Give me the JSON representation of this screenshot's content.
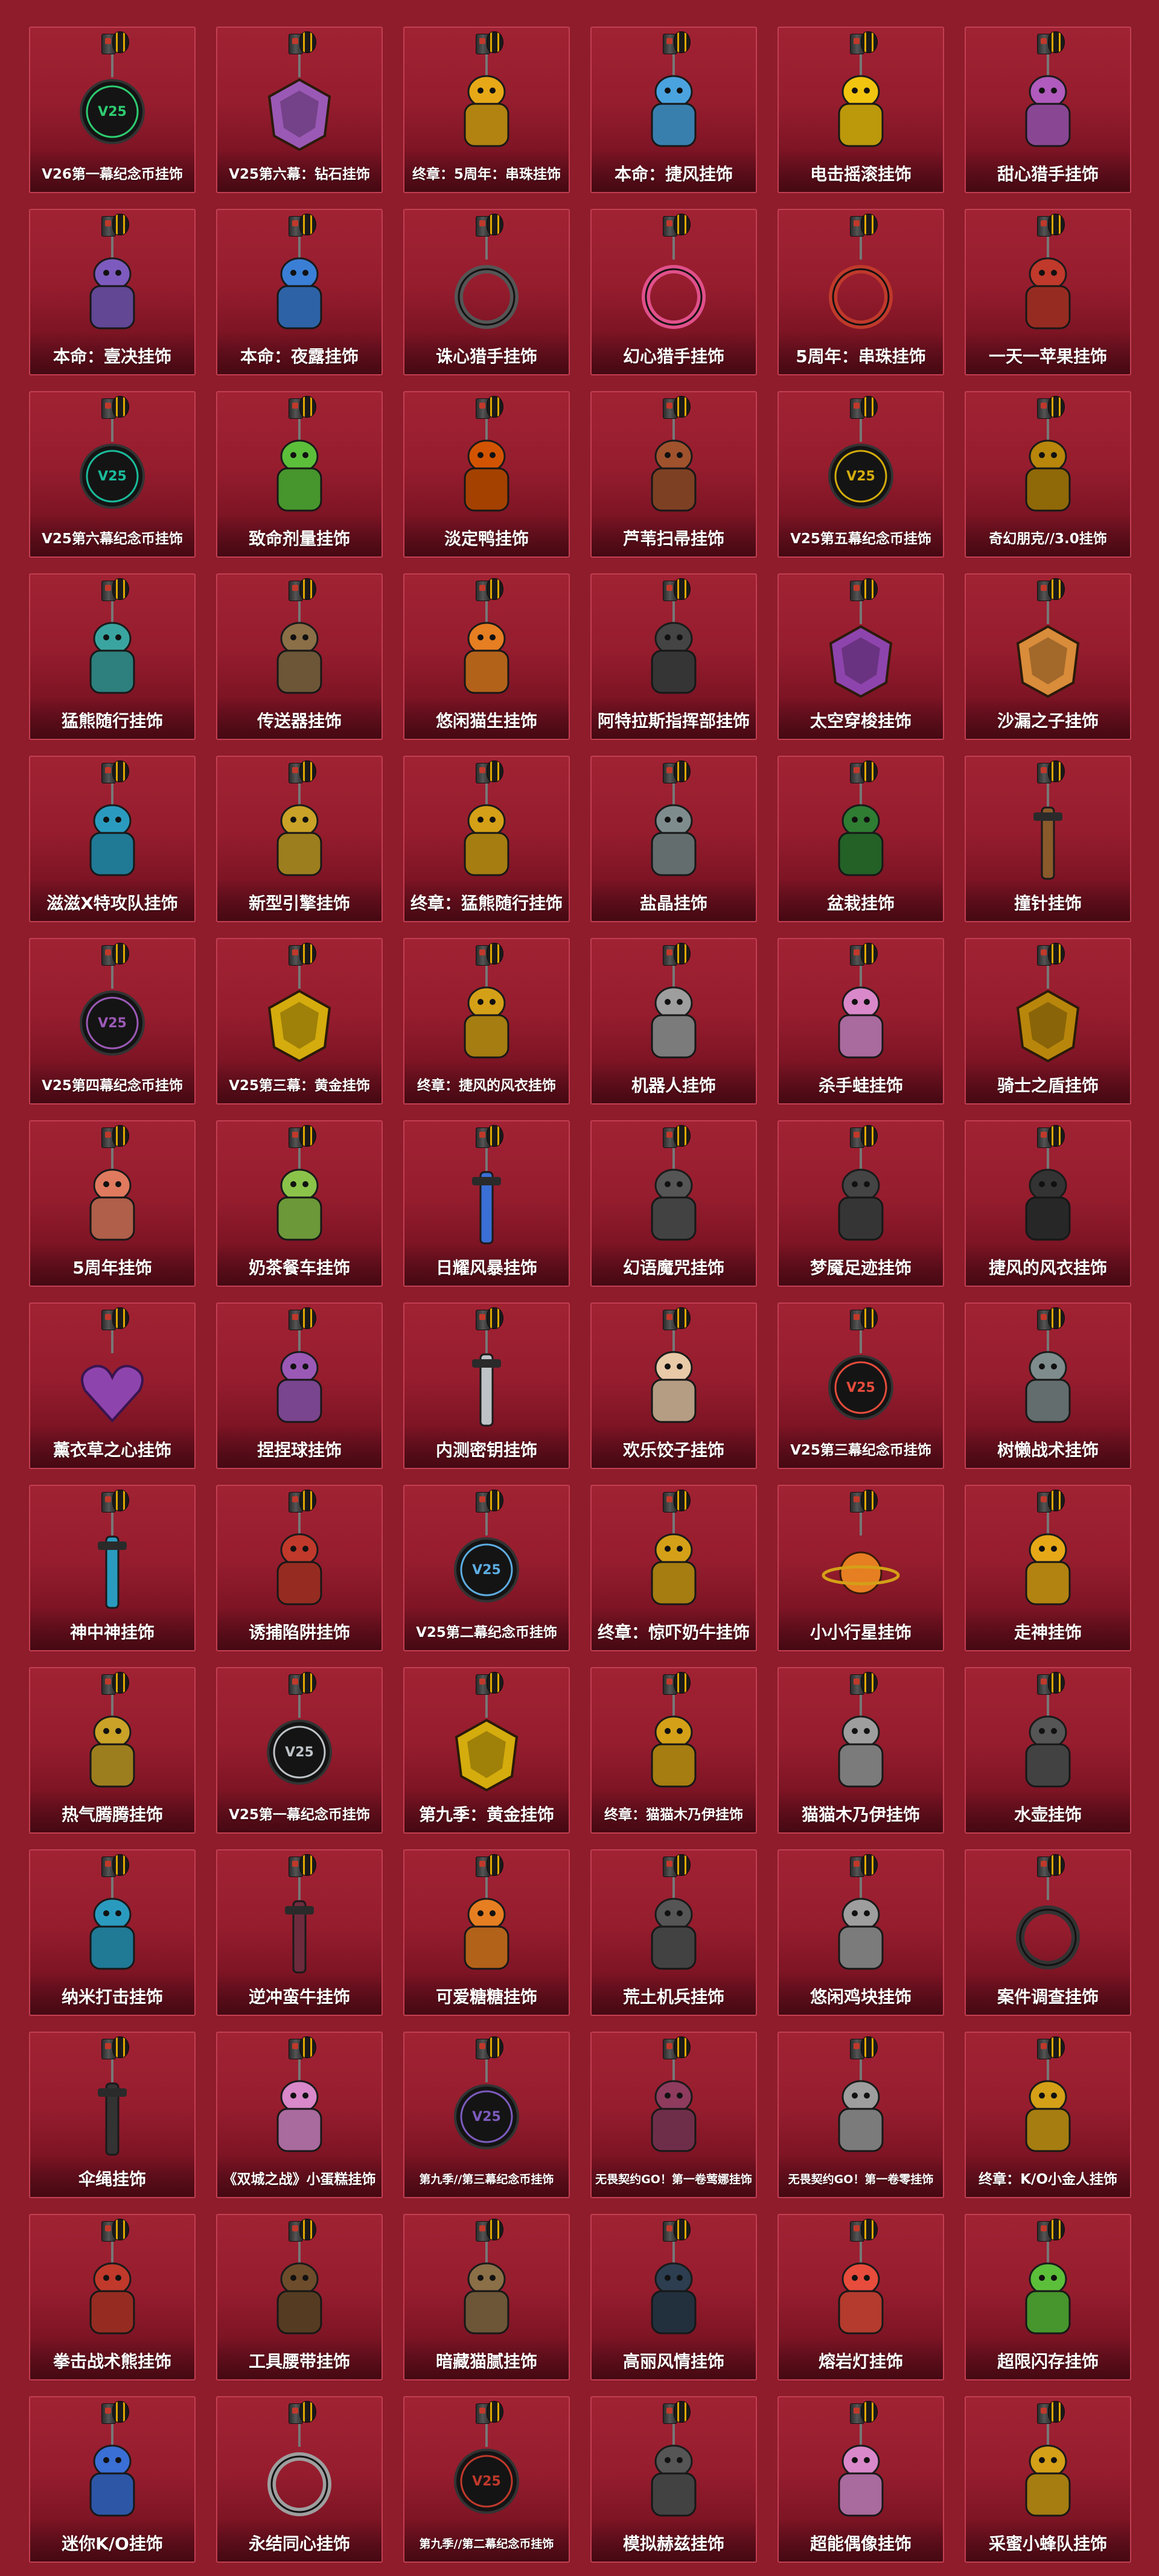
{
  "grid": {
    "columns": 6,
    "items": [
      {
        "label": "V26第一幕纪念币挂饰",
        "icon": "medallion-icon",
        "color": "#2ecc71"
      },
      {
        "label": "V25第六幕：钻石挂饰",
        "icon": "diamond-badge-icon",
        "color": "#9b59b6"
      },
      {
        "label": "终章：5周年：串珠挂饰",
        "icon": "bead-five-icon",
        "color": "#e6a817"
      },
      {
        "label": "本命：捷风挂饰",
        "icon": "character-figure-icon",
        "color": "#4aa3df"
      },
      {
        "label": "电击摇滚挂饰",
        "icon": "lightning-icon",
        "color": "#f1c40f"
      },
      {
        "label": "甜心猎手挂饰",
        "icon": "backpack-icon",
        "color": "#b05bbd"
      },
      {
        "label": "本命：壹决挂饰",
        "icon": "character-figure-icon",
        "color": "#7d5bbe"
      },
      {
        "label": "本命：夜露挂饰",
        "icon": "character-figure-icon",
        "color": "#3a7fd5"
      },
      {
        "label": "诛心猎手挂饰",
        "icon": "headphones-icon",
        "color": "#555555"
      },
      {
        "label": "幻心猎手挂饰",
        "icon": "headphones-icon",
        "color": "#e0508a"
      },
      {
        "label": "5周年：串珠挂饰",
        "icon": "bead-ring-icon",
        "color": "#c0392b"
      },
      {
        "label": "一天一苹果挂饰",
        "icon": "apple-icon",
        "color": "#c0392b"
      },
      {
        "label": "V25第六幕纪念币挂饰",
        "icon": "medallion-icon",
        "color": "#1abc9c"
      },
      {
        "label": "致命剂量挂饰",
        "icon": "snake-icon",
        "color": "#5cbf3a"
      },
      {
        "label": "淡定鸭挂饰",
        "icon": "duck-jar-icon",
        "color": "#d35400"
      },
      {
        "label": "芦苇扫帚挂饰",
        "icon": "broom-icon",
        "color": "#a0522d"
      },
      {
        "label": "V25第五幕纪念币挂饰",
        "icon": "medallion-icon",
        "color": "#d4ac0d"
      },
      {
        "label": "奇幻朋克//3.0挂饰",
        "icon": "helmet-icon",
        "color": "#b8860b"
      },
      {
        "label": "猛熊随行挂饰",
        "icon": "bear-icon",
        "color": "#3aa5a0"
      },
      {
        "label": "传送器挂饰",
        "icon": "teleporter-icon",
        "color": "#8b6f47"
      },
      {
        "label": "悠闲猫生挂饰",
        "icon": "lantern-icon",
        "color": "#e67e22"
      },
      {
        "label": "阿特拉斯指挥部挂饰",
        "icon": "atlas-logo-icon",
        "color": "#444444"
      },
      {
        "label": "太空穿梭挂饰",
        "icon": "shuttle-tag-icon",
        "color": "#8e44ad"
      },
      {
        "label": "沙漏之子挂饰",
        "icon": "hourglass-tag-icon",
        "color": "#d98c3a"
      },
      {
        "label": "滋滋X特攻队挂饰",
        "icon": "shark-icon",
        "color": "#2a9bbf"
      },
      {
        "label": "新型引擎挂饰",
        "icon": "rocket-icon",
        "color": "#c9a227"
      },
      {
        "label": "终章：猛熊随行挂饰",
        "icon": "golden-bear-icon",
        "color": "#d4a017"
      },
      {
        "label": "盐晶挂饰",
        "icon": "salt-crystal-icon",
        "color": "#7f8c8d"
      },
      {
        "label": "盆栽挂饰",
        "icon": "bonsai-icon",
        "color": "#2e7d32"
      },
      {
        "label": "撞针挂饰",
        "icon": "firing-pin-icon",
        "color": "#8b5a2b"
      },
      {
        "label": "V25第四幕纪念币挂饰",
        "icon": "medallion-icon",
        "color": "#9b59b6"
      },
      {
        "label": "V25第三幕：黄金挂饰",
        "icon": "gold-badge-icon",
        "color": "#d4ac0d"
      },
      {
        "label": "终章：捷风的风衣挂饰",
        "icon": "golden-jacket-icon",
        "color": "#d4a017"
      },
      {
        "label": "机器人挂饰",
        "icon": "robot-icon",
        "color": "#9e9e9e"
      },
      {
        "label": "杀手蛙挂饰",
        "icon": "frog-icon",
        "color": "#d988c9"
      },
      {
        "label": "骑士之盾挂饰",
        "icon": "shield-icon",
        "color": "#b8860b"
      },
      {
        "label": "5周年挂饰",
        "icon": "cake-slice-icon",
        "color": "#e07a5f"
      },
      {
        "label": "奶茶餐车挂饰",
        "icon": "food-truck-icon",
        "color": "#8bc34a"
      },
      {
        "label": "日耀风暴挂饰",
        "icon": "crystal-blade-icon",
        "color": "#3a6fd5"
      },
      {
        "label": "幻语魔咒挂饰",
        "icon": "spellbook-icon",
        "color": "#555555"
      },
      {
        "label": "梦魇足迹挂饰",
        "icon": "paw-boots-icon",
        "color": "#444444"
      },
      {
        "label": "捷风的风衣挂饰",
        "icon": "jacket-icon",
        "color": "#333333"
      },
      {
        "label": "薰衣草之心挂饰",
        "icon": "heart-icon",
        "color": "#8e44ad"
      },
      {
        "label": "捏捏球挂饰",
        "icon": "squishy-ball-icon",
        "color": "#9b59b6"
      },
      {
        "label": "内测密钥挂饰",
        "icon": "key-icon",
        "color": "#bdc3c7"
      },
      {
        "label": "欢乐饺子挂饰",
        "icon": "dumpling-icon",
        "color": "#e8c9a8"
      },
      {
        "label": "V25第三幕纪念币挂饰",
        "icon": "medallion-icon",
        "color": "#e74c3c"
      },
      {
        "label": "树懒战术挂饰",
        "icon": "sloth-icon",
        "color": "#7f8c8d"
      },
      {
        "label": "神中神挂饰",
        "icon": "sword-icon",
        "color": "#2a9bbf"
      },
      {
        "label": "诱捕陷阱挂饰",
        "icon": "plant-trap-icon",
        "color": "#c0392b"
      },
      {
        "label": "V25第二幕纪念币挂饰",
        "icon": "medallion-icon",
        "color": "#5dade2"
      },
      {
        "label": "终章：惊吓奶牛挂饰",
        "icon": "golden-cow-icon",
        "color": "#d4a017"
      },
      {
        "label": "小小行星挂饰",
        "icon": "planet-icon",
        "color": "#e67e22"
      },
      {
        "label": "走神挂饰",
        "icon": "ghost-icon",
        "color": "#e6a817"
      },
      {
        "label": "热气腾腾挂饰",
        "icon": "frying-pan-icon",
        "color": "#c9a227"
      },
      {
        "label": "V25第一幕纪念币挂饰",
        "icon": "medallion-icon",
        "color": "#bdc3c7"
      },
      {
        "label": "第九季：黄金挂饰",
        "icon": "gold-badge-icon",
        "color": "#d4ac0d"
      },
      {
        "label": "终章：猫猫木乃伊挂饰",
        "icon": "golden-mummy-cat-icon",
        "color": "#d4a017"
      },
      {
        "label": "猫猫木乃伊挂饰",
        "icon": "mummy-cat-icon",
        "color": "#9e9e9e"
      },
      {
        "label": "水壶挂饰",
        "icon": "canteen-icon",
        "color": "#555555"
      },
      {
        "label": "纳米打击挂饰",
        "icon": "battery-icon",
        "color": "#2a9bbf"
      },
      {
        "label": "逆冲蛮牛挂饰",
        "icon": "chain-weapon-icon",
        "color": "#6d2b3d"
      },
      {
        "label": "可爱糖糖挂饰",
        "icon": "candy-corn-icon",
        "color": "#e67e22"
      },
      {
        "label": "荒土机兵挂饰",
        "icon": "mech-drone-icon",
        "color": "#555555"
      },
      {
        "label": "悠闲鸡块挂饰",
        "icon": "nugget-box-icon",
        "color": "#9e9e9e"
      },
      {
        "label": "案件调查挂饰",
        "icon": "magnifier-icon",
        "color": "#333333"
      },
      {
        "label": "伞绳挂饰",
        "icon": "paracord-icon",
        "color": "#333333"
      },
      {
        "label": "《双城之战》小蛋糕挂饰",
        "icon": "cupcake-icon",
        "color": "#d988c9"
      },
      {
        "label": "第九季//第三幕纪念币挂饰",
        "icon": "medallion-icon",
        "color": "#7d5bbe"
      },
      {
        "label": "无畏契约GO！第一卷莺娜挂饰",
        "icon": "character-figure-icon",
        "color": "#8e3b5e"
      },
      {
        "label": "无畏契约GO！第一卷零挂饰",
        "icon": "character-figure-icon",
        "color": "#9e9e9e"
      },
      {
        "label": "终章：K/O小金人挂饰",
        "icon": "golden-robot-icon",
        "color": "#d4a017"
      },
      {
        "label": "拳击战术熊挂饰",
        "icon": "boxing-bear-icon",
        "color": "#c0392b"
      },
      {
        "label": "工具腰带挂饰",
        "icon": "tool-belt-icon",
        "color": "#6d4c2b"
      },
      {
        "label": "暗藏猫腻挂饰",
        "icon": "cat-box-icon",
        "color": "#8b6f47"
      },
      {
        "label": "高丽风情挂饰",
        "icon": "hanbok-icon",
        "color": "#2c3e50"
      },
      {
        "label": "熔岩灯挂饰",
        "icon": "lava-lamp-icon",
        "color": "#e74c3c"
      },
      {
        "label": "超限闪存挂饰",
        "icon": "flash-drive-icon",
        "color": "#5cbf3a"
      },
      {
        "label": "迷你K/O挂饰",
        "icon": "mini-robot-icon",
        "color": "#3a6fd5"
      },
      {
        "label": "永结同心挂饰",
        "icon": "ring-icon",
        "color": "#9e9e9e"
      },
      {
        "label": "第九季//第二幕纪念币挂饰",
        "icon": "medallion-icon",
        "color": "#c0392b"
      },
      {
        "label": "模拟赫兹挂饰",
        "icon": "radio-icon",
        "color": "#555555"
      },
      {
        "label": "超能偶像挂饰",
        "icon": "idol-figure-icon",
        "color": "#d988c9"
      },
      {
        "label": "采蜜小蜂队挂饰",
        "icon": "beehive-icon",
        "color": "#d4a017"
      }
    ]
  }
}
